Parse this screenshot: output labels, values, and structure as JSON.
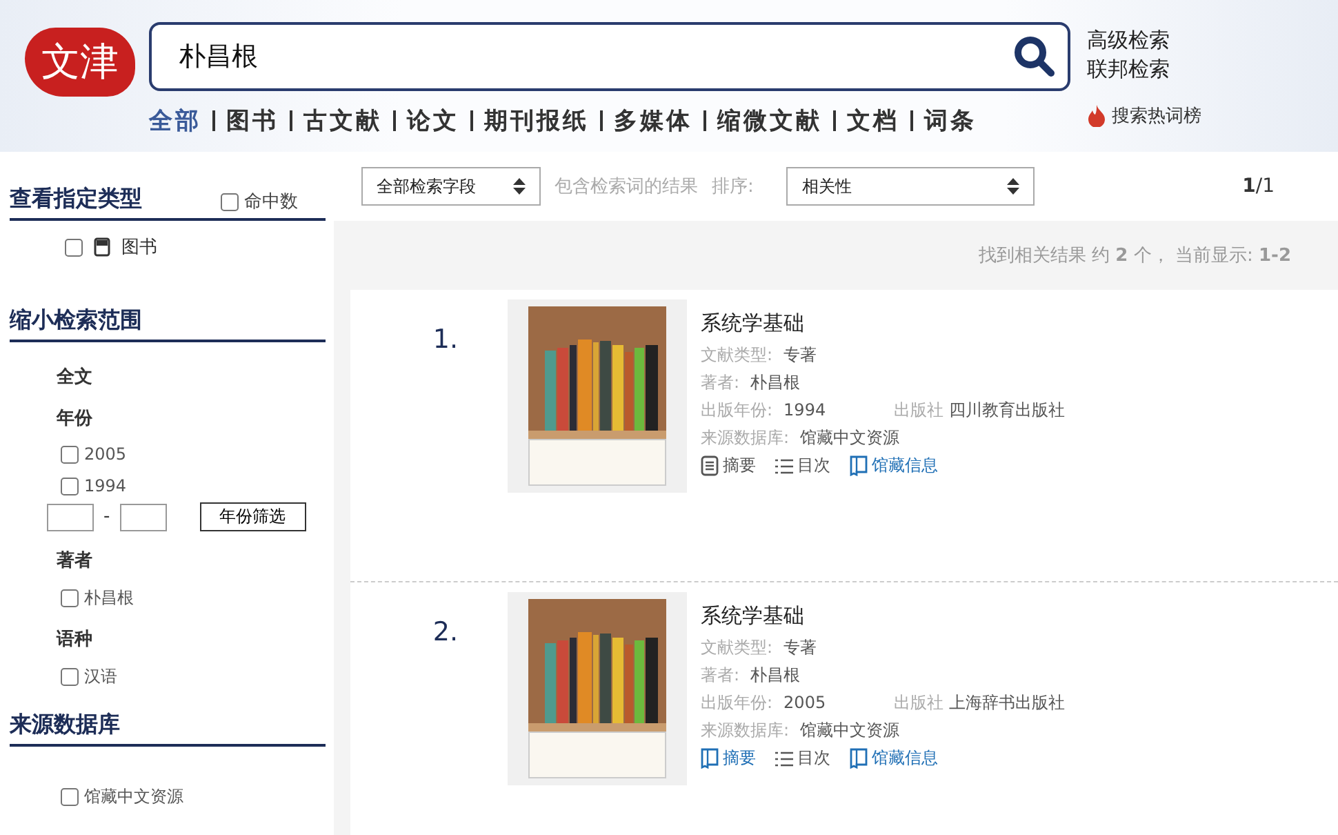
{
  "header": {
    "logo": "文津",
    "search": {
      "value": "朴昌根"
    },
    "links": [
      "高级检索",
      "联邦检索"
    ],
    "categories": [
      {
        "label": "全部",
        "selected": true
      },
      {
        "label": "图书",
        "selected": false
      },
      {
        "label": "古文献",
        "selected": false
      },
      {
        "label": "论文",
        "selected": false
      },
      {
        "label": "期刊报纸",
        "selected": false
      },
      {
        "label": "多媒体",
        "selected": false
      },
      {
        "label": "缩微文献",
        "selected": false
      },
      {
        "label": "文档",
        "selected": false
      },
      {
        "label": "词条",
        "selected": false
      }
    ],
    "hot": "搜索热词榜"
  },
  "sidebar": {
    "type_section": {
      "title": "查看指定类型",
      "hit_count": {
        "label": "命中数",
        "checked": false
      },
      "types": [
        {
          "label": "图书",
          "checked": false
        }
      ]
    },
    "narrow_section": {
      "title": "缩小检索范围",
      "groups": [
        {
          "title": "全文"
        },
        {
          "title": "年份",
          "options": [
            {
              "label": "2005",
              "checked": false
            },
            {
              "label": "1994",
              "checked": false
            }
          ],
          "range": {
            "separator": "-",
            "button": "年份筛选"
          }
        },
        {
          "title": "著者",
          "options": [
            {
              "label": "朴昌根",
              "checked": false
            }
          ]
        },
        {
          "title": "语种",
          "options": [
            {
              "label": "汉语",
              "checked": false
            }
          ]
        }
      ]
    },
    "source_section": {
      "title": "来源数据库",
      "options": [
        {
          "label": "馆藏中文资源",
          "checked": false
        }
      ]
    }
  },
  "toolbar": {
    "field_select": "全部检索字段",
    "hint": "包含检索词的结果",
    "sort_label": "排序:",
    "sort_select": "相关性",
    "page": {
      "current": "1",
      "total": "/1"
    }
  },
  "summary": {
    "prefix": "找到相关结果 约",
    "count": "2",
    "middle": "个，  当前显示:",
    "range": "1-2"
  },
  "results": [
    {
      "number": "1.",
      "title": "系统学基础",
      "fields": [
        {
          "label": "文献类型:",
          "value": "专著"
        },
        {
          "label": "著者:",
          "value": "朴昌根"
        }
      ],
      "year_label": "出版年份:",
      "year": "1994",
      "publisher_label": "出版社",
      "publisher": "四川教育出版社",
      "source_label": "来源数据库:",
      "source": "馆藏中文资源",
      "actions": [
        {
          "kind": "doc",
          "label": "摘要",
          "link": false
        },
        {
          "kind": "list",
          "label": "目次",
          "link": false
        },
        {
          "kind": "book",
          "label": "馆藏信息",
          "link": true
        }
      ]
    },
    {
      "number": "2.",
      "title": "系统学基础",
      "fields": [
        {
          "label": "文献类型:",
          "value": "专著"
        },
        {
          "label": "著者:",
          "value": "朴昌根"
        }
      ],
      "year_label": "出版年份:",
      "year": "2005",
      "publisher_label": "出版社",
      "publisher": "上海辞书出版社",
      "source_label": "来源数据库:",
      "source": "馆藏中文资源",
      "actions": [
        {
          "kind": "book",
          "label": "摘要",
          "link": true
        },
        {
          "kind": "list",
          "label": "目次",
          "link": false
        },
        {
          "kind": "book",
          "label": "馆藏信息",
          "link": true
        }
      ]
    }
  ]
}
